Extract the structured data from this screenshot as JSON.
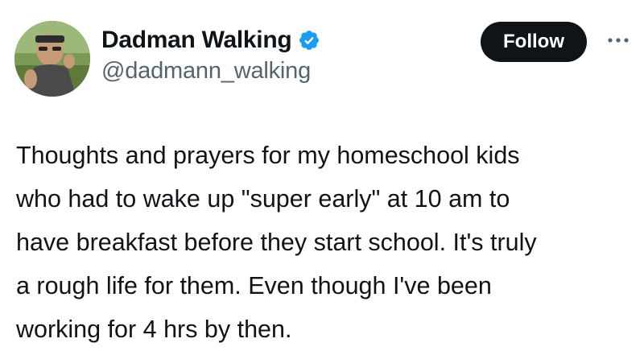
{
  "author": {
    "display_name": "Dadman Walking",
    "handle": "@dadmann_walking",
    "verified": true,
    "avatar_icon": "profile-photo"
  },
  "actions": {
    "follow_label": "Follow",
    "more_icon": "more-options-icon"
  },
  "tweet": {
    "lines": [
      "Thoughts and prayers for my homeschool kids",
      "who had to wake up \"super early\" at 10 am to",
      "have breakfast before they start school. It's truly",
      "a rough life for them. Even though I've been",
      "working for 4 hrs by then."
    ]
  },
  "colors": {
    "text": "#0f1419",
    "secondary_text": "#536471",
    "verified_badge": "#1d9bf0",
    "follow_button_bg": "#0f1419",
    "follow_button_text": "#ffffff"
  }
}
